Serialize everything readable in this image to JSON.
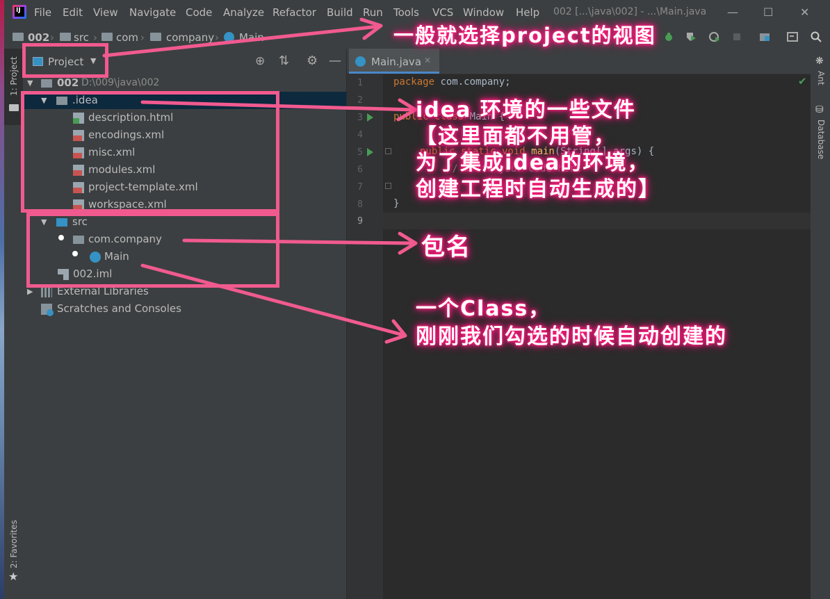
{
  "app": {
    "logo_text": "IJ",
    "title": "002 [...\\java\\002] - ...\\Main.java"
  },
  "menu": [
    "File",
    "Edit",
    "View",
    "Navigate",
    "Code",
    "Analyze",
    "Refactor",
    "Build",
    "Run",
    "Tools",
    "VCS",
    "Window",
    "Help"
  ],
  "breadcrumb": [
    "002",
    "src",
    "com",
    "company",
    "Main"
  ],
  "left_stripe": {
    "project_tab": "1: Project",
    "favorites_tab": "2: Favorites"
  },
  "right_stripe": {
    "ant_tab": "Ant",
    "database_tab": "Database"
  },
  "project_panel": {
    "view_selector": "Project",
    "tree": [
      {
        "label": "002",
        "path": "D:\\009\\java\\002",
        "kind": "module",
        "depth": 0,
        "expanded": true
      },
      {
        "label": ".idea",
        "kind": "folder",
        "depth": 1,
        "expanded": true,
        "selected": true
      },
      {
        "label": "description.html",
        "kind": "html",
        "depth": 2
      },
      {
        "label": "encodings.xml",
        "kind": "xml",
        "depth": 2
      },
      {
        "label": "misc.xml",
        "kind": "xml",
        "depth": 2
      },
      {
        "label": "modules.xml",
        "kind": "xml",
        "depth": 2
      },
      {
        "label": "project-template.xml",
        "kind": "xml",
        "depth": 2
      },
      {
        "label": "workspace.xml",
        "kind": "xml",
        "depth": 2
      },
      {
        "label": "src",
        "kind": "src-folder",
        "depth": 1,
        "expanded": true
      },
      {
        "label": "com.company",
        "kind": "package",
        "depth": 2
      },
      {
        "label": "Main",
        "kind": "class",
        "depth": 3
      },
      {
        "label": "002.iml",
        "kind": "iml",
        "depth": 1
      },
      {
        "label": "External Libraries",
        "kind": "libraries",
        "depth": 0
      },
      {
        "label": "Scratches and Consoles",
        "kind": "scratches",
        "depth": 0
      }
    ]
  },
  "editor": {
    "tab_label": "Main.java",
    "line_numbers": [
      "1",
      "2",
      "3",
      "4",
      "5",
      "6",
      "7",
      "8",
      "9"
    ],
    "code": {
      "l1_kw": "package",
      "l1_rest": " com.company;",
      "l3_kw": "public class",
      "l3_rest": " Main {",
      "l5_kw": "public static void",
      "l5_fn": " main",
      "l5_rest": "(String[] args) {",
      "l6_cm": "// write your code here",
      "l7": "}",
      "l8": "}"
    }
  },
  "annotations": {
    "a1": "一般就选择project的视图",
    "a2_l1": "idea 环境的一些文件",
    "a2_l2": "【这里面都不用管，",
    "a2_l3": "为了集成idea的环境，",
    "a2_l4": "创建工程时自动生成的】",
    "a3": "包名",
    "a4_l1": "一个Class，",
    "a4_l2": "刚刚我们勾选的时候自动创建的"
  },
  "colors": {
    "annotation": "#f15a8f",
    "selection": "#0d293e",
    "keyword": "#cc7832",
    "function": "#ffc66d"
  }
}
